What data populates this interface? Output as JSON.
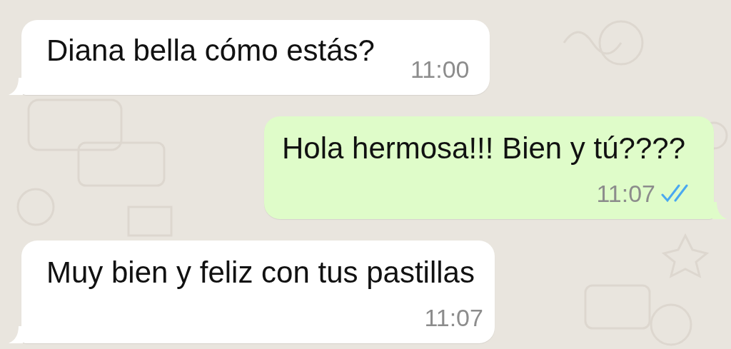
{
  "messages": [
    {
      "kind": "incoming",
      "text": "Diana bella cómo estás?",
      "time": "11:00"
    },
    {
      "kind": "outgoing",
      "text": "Hola hermosa!!! Bien y tú????",
      "time": "11:07",
      "read": true
    },
    {
      "kind": "incoming",
      "text": "Muy bien y feliz con tus pastillas",
      "time": "11:07"
    }
  ]
}
